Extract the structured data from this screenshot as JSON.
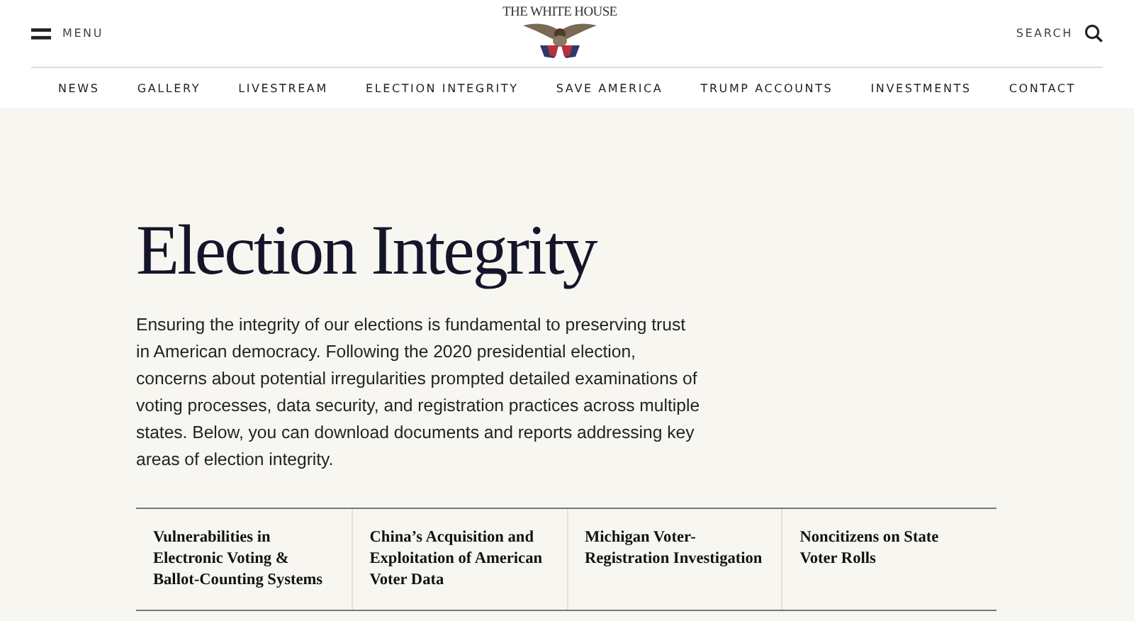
{
  "header": {
    "menu_label": "MENU",
    "logo_text": "THE WHITE HOUSE",
    "search_label": "SEARCH"
  },
  "nav": [
    {
      "label": "NEWS"
    },
    {
      "label": "GALLERY"
    },
    {
      "label": "LIVESTREAM"
    },
    {
      "label": "ELECTION INTEGRITY"
    },
    {
      "label": "SAVE AMERICA"
    },
    {
      "label": "TRUMP ACCOUNTS"
    },
    {
      "label": "INVESTMENTS"
    },
    {
      "label": "CONTACT"
    }
  ],
  "page": {
    "title": "Election Integrity",
    "intro": "Ensuring the integrity of our elections is fundamental to preserving trust in American democracy. Following the 2020 presidential election, concerns about potential irregularities prompted detailed examinations of voting processes, data security, and registration practices across multiple states. Below, you can download documents and reports addressing key areas of election integrity."
  },
  "documents": [
    {
      "title": "Vulnerabilities in Electronic Voting & Ballot-Counting Systems"
    },
    {
      "title": "China’s Acquisition and Exploitation of American Voter Data"
    },
    {
      "title": "Michigan Voter-Registration Investigation"
    },
    {
      "title": "Noncitizens on State Voter Rolls"
    }
  ]
}
